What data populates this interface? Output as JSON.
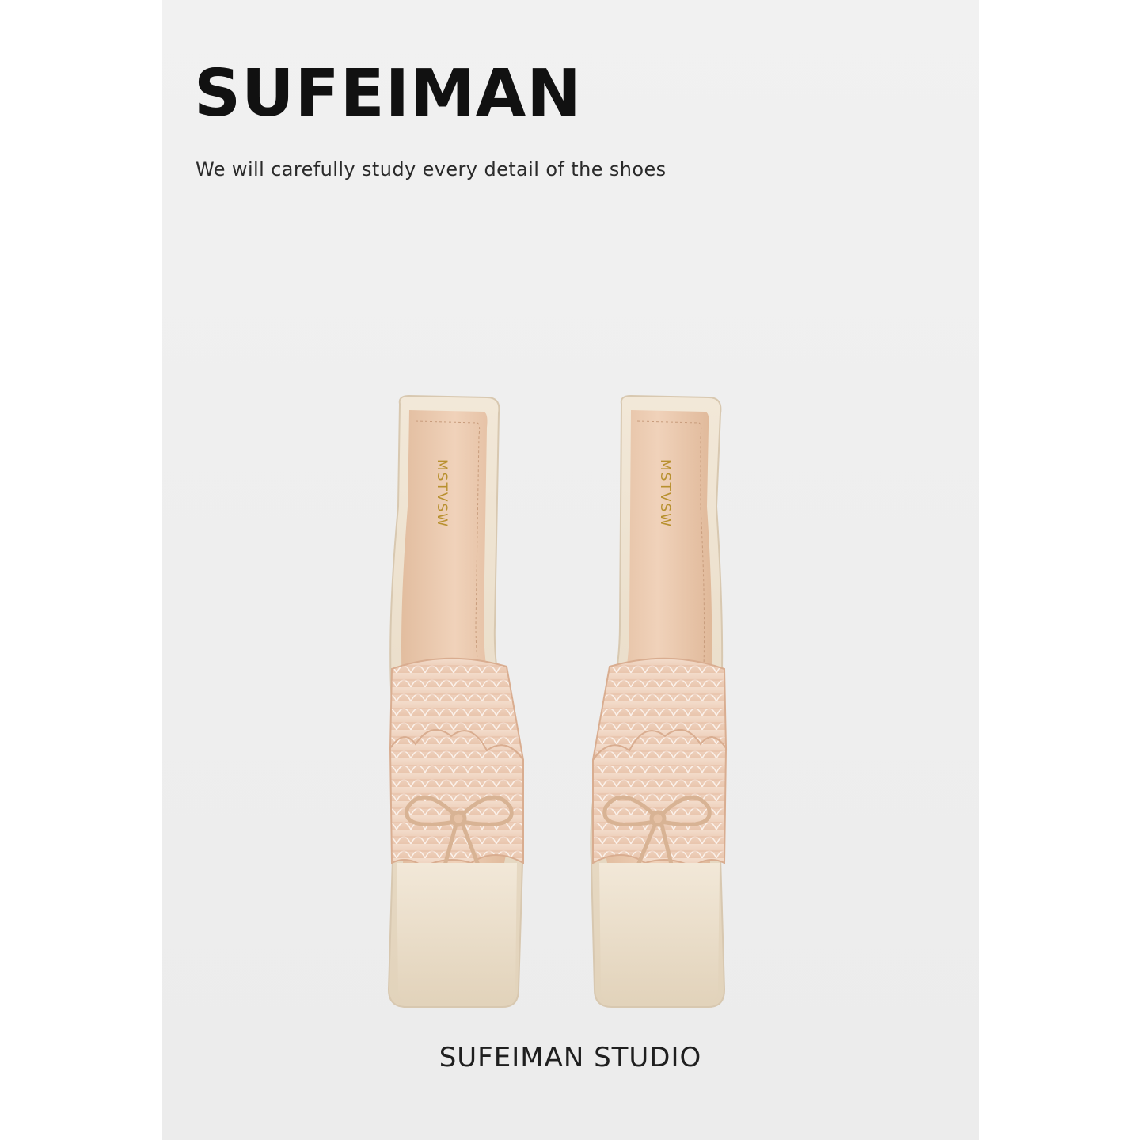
{
  "brand": {
    "title": "SUFEIMAN",
    "tagline": "We will carefully study every detail of the shoes",
    "studio": "SUFEIMAN STUDIO"
  },
  "product": {
    "insole_logo": "MSTVSW",
    "colors": {
      "panel_background": "#eeeeee",
      "insole": "#e8c6aa",
      "satin_upper": "#ece0cc",
      "lace": "#efcdb7",
      "logo_gold": "#b8902e"
    }
  }
}
